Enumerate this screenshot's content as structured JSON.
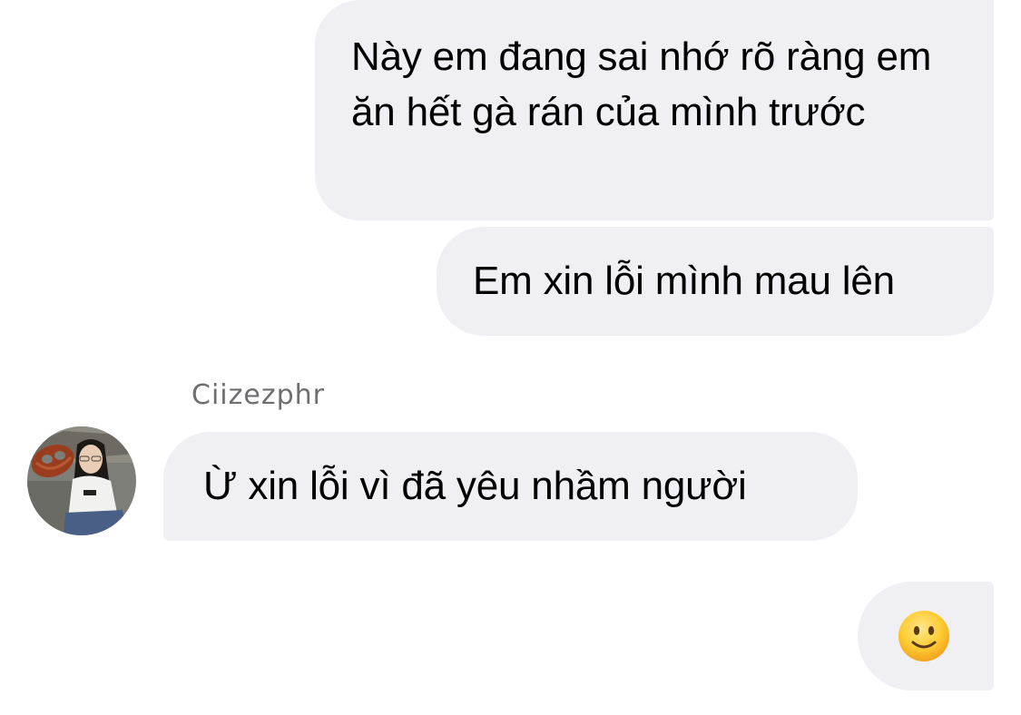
{
  "conversation": {
    "messages": [
      {
        "direction": "outgoing",
        "text": "Này em đang sai nhớ rõ ràng em ăn hết gà rán của mình trước"
      },
      {
        "direction": "outgoing",
        "text": "Em xin lỗi mình mau lên"
      },
      {
        "direction": "incoming",
        "text": "Ừ xin lỗi vì đã yêu nhầm người"
      },
      {
        "direction": "outgoing",
        "emoji": "slightly-smiling-face-icon"
      }
    ],
    "incoming_sender": {
      "name": "Ciizezphr",
      "avatar": "profile-photo"
    }
  },
  "colors": {
    "bubble_background": "#efeff4",
    "message_text": "#000000",
    "sender_name_text": "#6e6e73",
    "page_background": "#ffffff"
  }
}
